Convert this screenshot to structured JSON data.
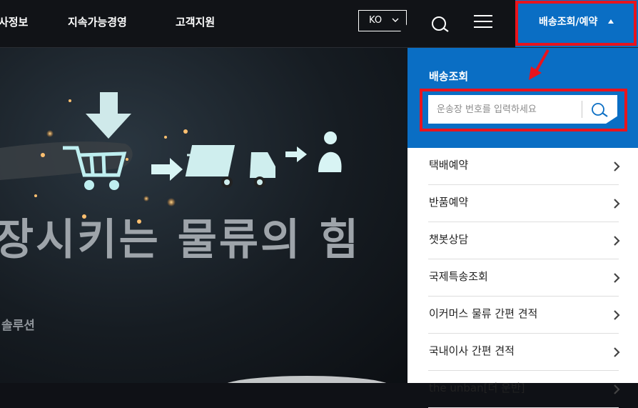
{
  "nav": {
    "items": [
      "사정보",
      "지속가능경영",
      "고객지원"
    ],
    "language": "KO",
    "track_button": "배송조회/예약"
  },
  "hero": {
    "headline": "장시키는 물류의 힘",
    "sub": "솔루션"
  },
  "panel": {
    "title": "배송조회",
    "search": {
      "placeholder": "운송장 번호를 입력하세요",
      "value": ""
    },
    "menu": [
      "택배예약",
      "반품예약",
      "챗봇상담",
      "국제특송조회",
      "이커머스 물류 간편 견적",
      "국내이사 간편 견적",
      "the unban[더 운반]"
    ]
  },
  "colors": {
    "brand_blue": "#0a6ec4",
    "highlight_red": "#e8141d",
    "topbar": "#111317"
  }
}
